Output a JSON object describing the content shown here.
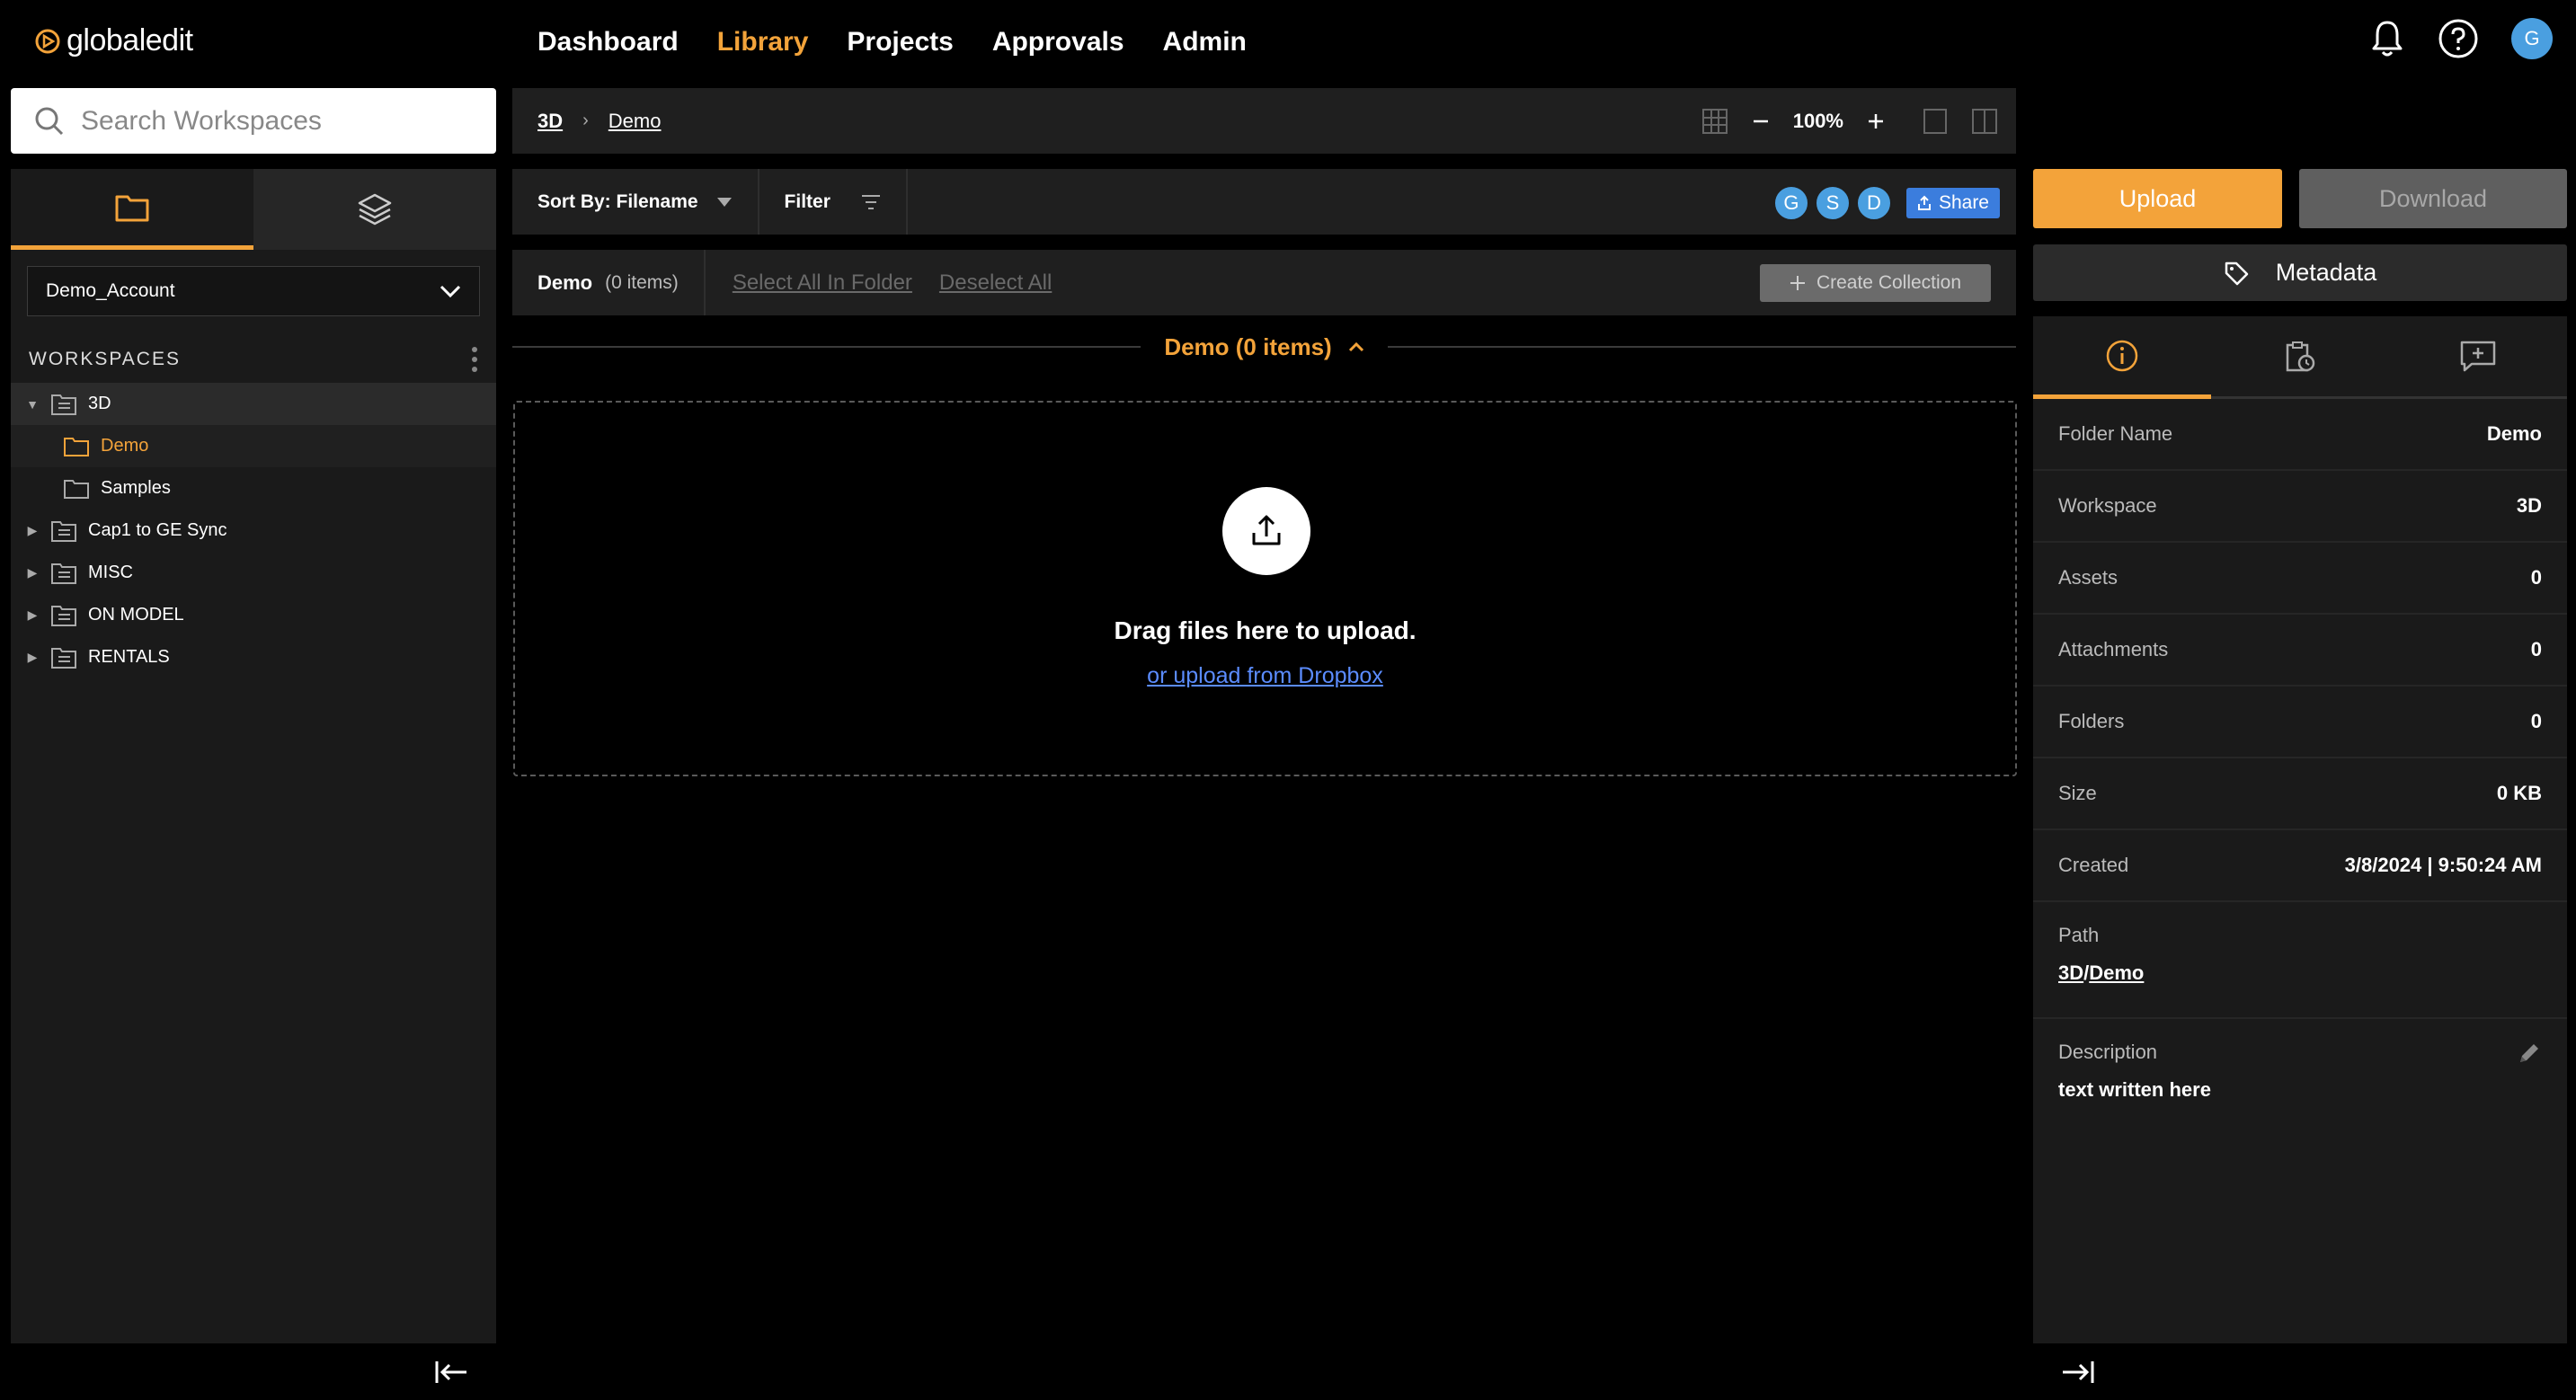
{
  "app": {
    "logo_text": "globaledit"
  },
  "nav": {
    "items": [
      {
        "label": "Dashboard",
        "active": false
      },
      {
        "label": "Library",
        "active": true
      },
      {
        "label": "Projects",
        "active": false
      },
      {
        "label": "Approvals",
        "active": false
      },
      {
        "label": "Admin",
        "active": false
      }
    ],
    "user_initial": "G"
  },
  "search": {
    "placeholder": "Search Workspaces"
  },
  "sidebar": {
    "account": "Demo_Account",
    "workspaces_title": "WORKSPACES",
    "tree": [
      {
        "label": "3D",
        "expanded": true
      },
      {
        "label": "Demo"
      },
      {
        "label": "Samples"
      },
      {
        "label": "Cap1 to GE Sync"
      },
      {
        "label": "MISC"
      },
      {
        "label": "ON MODEL"
      },
      {
        "label": "RENTALS"
      }
    ]
  },
  "breadcrumb": {
    "items": [
      "3D",
      "Demo"
    ],
    "zoom": "100%"
  },
  "toolbar": {
    "sort_label": "Sort By: Filename",
    "filter_label": "Filter",
    "users": [
      "G",
      "S",
      "D"
    ],
    "share_label": "Share"
  },
  "folder_bar": {
    "name": "Demo",
    "count": "(0 items)",
    "select_all": "Select All In Folder",
    "deselect_all": "Deselect All",
    "create_collection": "Create Collection"
  },
  "section": {
    "title": "Demo (0 items)"
  },
  "dropzone": {
    "title": "Drag files here to upload.",
    "link": "or upload from Dropbox"
  },
  "actions": {
    "upload": "Upload",
    "download": "Download",
    "metadata": "Metadata"
  },
  "details": {
    "folder_name": {
      "label": "Folder Name",
      "value": "Demo"
    },
    "workspace": {
      "label": "Workspace",
      "value": "3D"
    },
    "assets": {
      "label": "Assets",
      "value": "0"
    },
    "attachments": {
      "label": "Attachments",
      "value": "0"
    },
    "folders": {
      "label": "Folders",
      "value": "0"
    },
    "size": {
      "label": "Size",
      "value": "0 KB"
    },
    "created": {
      "label": "Created",
      "value": "3/8/2024 | 9:50:24 AM"
    },
    "path": {
      "label": "Path",
      "part1": "3D",
      "sep": "/",
      "part2": "Demo"
    },
    "description": {
      "label": "Description",
      "value": "text written here"
    }
  },
  "colors": {
    "accent": "#f3a33a",
    "avatar": "#4a9fe0",
    "share": "#3b7ddd",
    "link": "#5b8cff"
  }
}
